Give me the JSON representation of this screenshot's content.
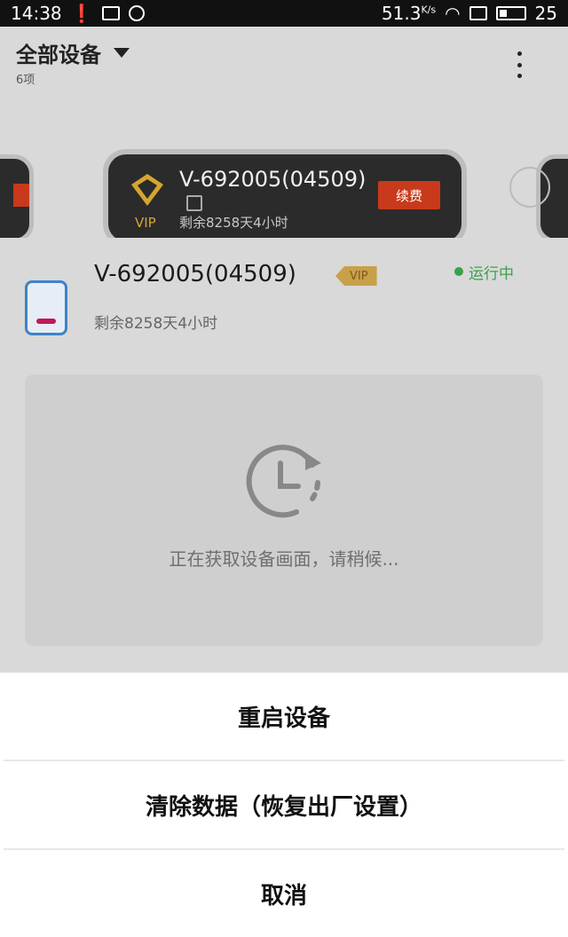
{
  "status_bar": {
    "time": "14:38",
    "net_speed": "51.3",
    "net_unit": "K/s",
    "battery": "25"
  },
  "header": {
    "title": "全部设备",
    "count": "6项"
  },
  "device_card": {
    "name": "V-692005(04509)",
    "vip_label": "VIP",
    "remaining": "剩余8258天4小时",
    "renew_label": "续费"
  },
  "device_detail": {
    "name": "V-692005(04509)",
    "vip_label": "VIP",
    "status": "运行中",
    "remaining": "剩余8258天4小时",
    "loading_text": "正在获取设备画面，请稍候..."
  },
  "action_sheet": {
    "items": [
      {
        "label": "重启设备"
      },
      {
        "label": "清除数据（恢复出厂设置）"
      },
      {
        "label": "取消"
      }
    ]
  },
  "colors": {
    "accent_red": "#c9391b",
    "vip_gold": "#c8a04a",
    "status_green": "#3aa14b",
    "device_blue": "#3d83c7"
  }
}
